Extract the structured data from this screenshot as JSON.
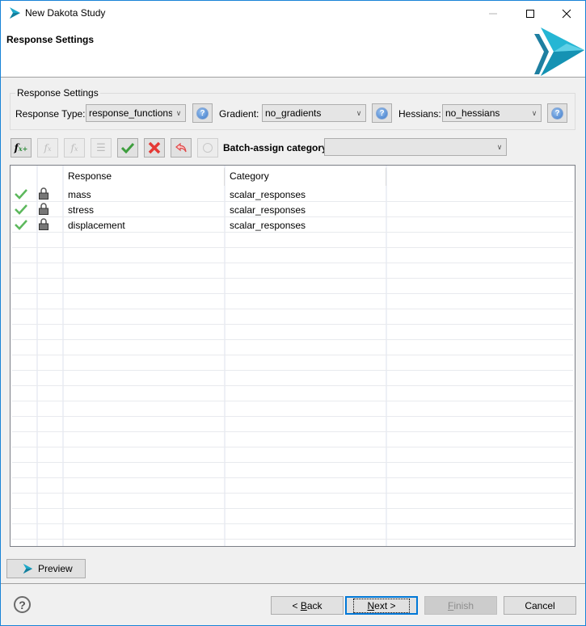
{
  "window": {
    "title": "New Dakota Study",
    "controls": {
      "minimize": "minimize",
      "maximize": "maximize",
      "close": "close"
    }
  },
  "header": {
    "page_title": "Response Settings"
  },
  "settings_group": {
    "legend": "Response Settings",
    "response_type": {
      "label": "Response Type:",
      "value": "response_functions"
    },
    "gradient": {
      "label": "Gradient:",
      "value": "no_gradients"
    },
    "hessians": {
      "label": "Hessians:",
      "value": "no_hessians"
    }
  },
  "toolbar": {
    "buttons": [
      {
        "name": "add-response",
        "icon": "f(x)+",
        "enabled": true
      },
      {
        "name": "edit-response",
        "icon": "f(x)-edit",
        "enabled": false
      },
      {
        "name": "delete-response",
        "icon": "f(x)-x",
        "enabled": false
      },
      {
        "name": "list",
        "icon": "list",
        "enabled": false
      },
      {
        "name": "check-all",
        "icon": "check",
        "enabled": true
      },
      {
        "name": "uncheck-all",
        "icon": "x",
        "enabled": true
      },
      {
        "name": "undo",
        "icon": "undo",
        "enabled": true
      },
      {
        "name": "refresh",
        "icon": "refresh",
        "enabled": false
      }
    ],
    "batch_label": "Batch-assign category:",
    "batch_value": ""
  },
  "table": {
    "columns": [
      "",
      "",
      "Response",
      "Category"
    ],
    "rows": [
      {
        "checked": true,
        "locked": true,
        "response": "mass",
        "category": "scalar_responses"
      },
      {
        "checked": true,
        "locked": true,
        "response": "stress",
        "category": "scalar_responses"
      },
      {
        "checked": true,
        "locked": true,
        "response": "displacement",
        "category": "scalar_responses"
      }
    ]
  },
  "preview_label": "Preview",
  "footer": {
    "help": "?",
    "back": {
      "pre": "< ",
      "mnemonic": "B",
      "rest": "ack"
    },
    "next": {
      "mnemonic": "N",
      "rest": "ext >"
    },
    "finish": {
      "mnemonic": "F",
      "rest": "inish"
    },
    "cancel": "Cancel"
  },
  "colors": {
    "accent": "#0078d7",
    "brand_teal": "#1ea9c9",
    "check_green": "#4caf50",
    "x_red": "#e53935"
  }
}
